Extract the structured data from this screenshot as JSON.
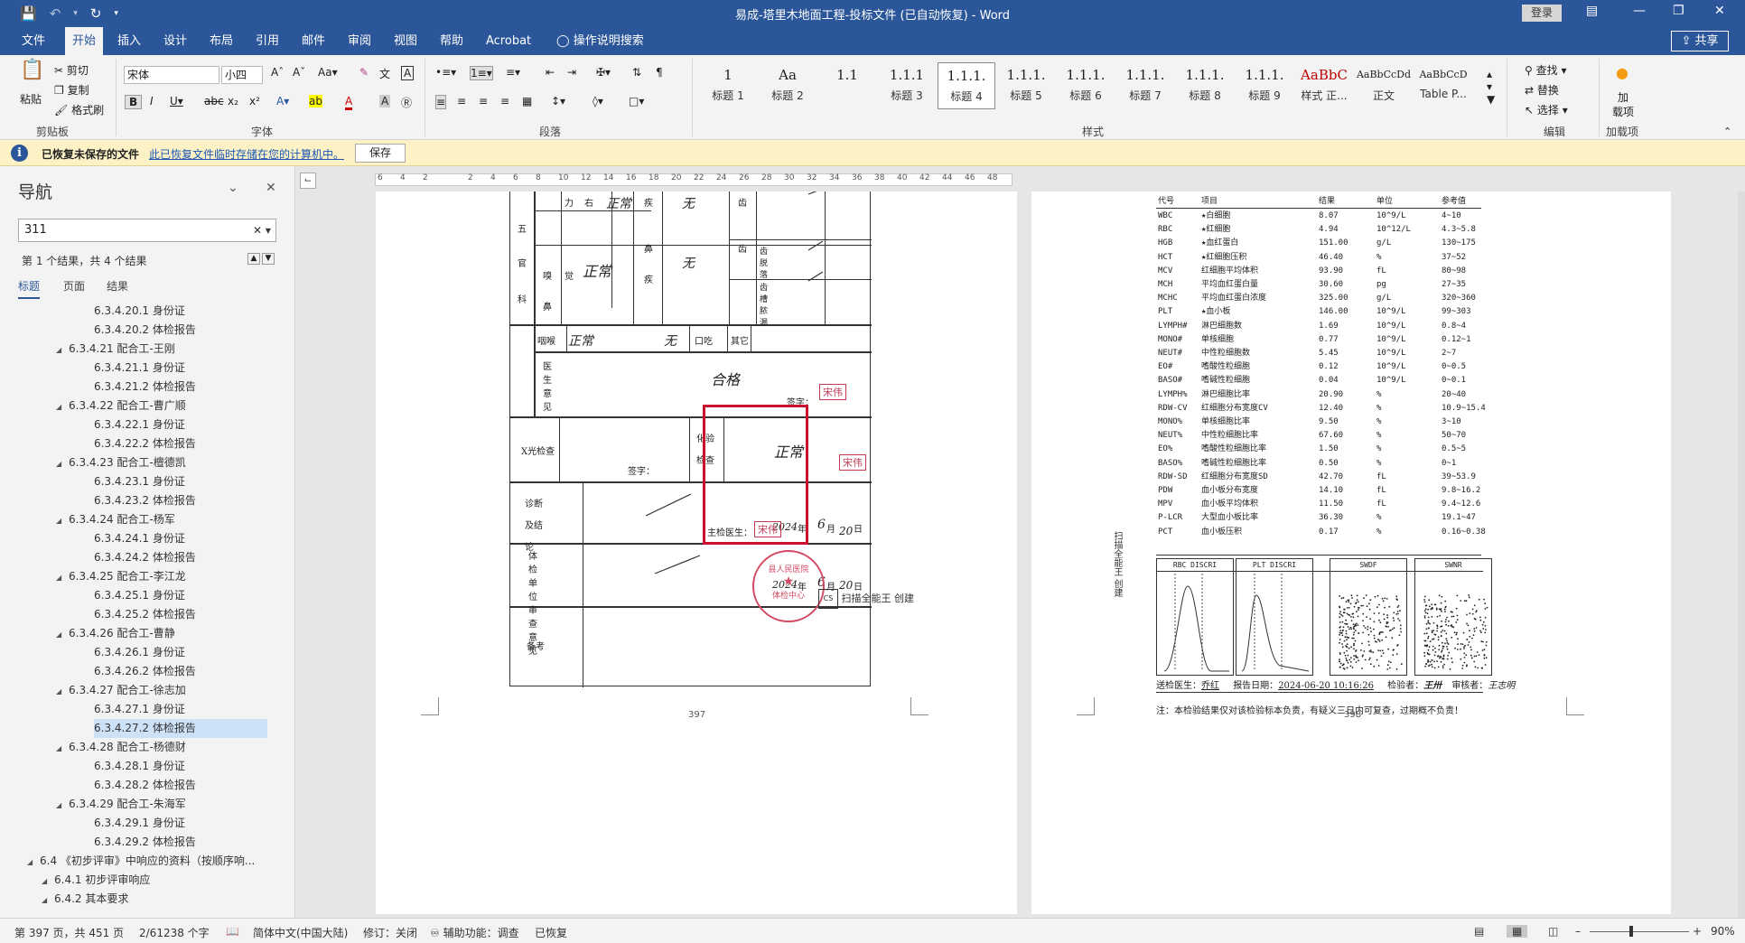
{
  "window": {
    "title": "易成-塔里木地面工程-投标文件 (已自动恢复)  -  Word",
    "login_label": "登录"
  },
  "menu": {
    "tabs": [
      "文件",
      "开始",
      "插入",
      "设计",
      "布局",
      "引用",
      "邮件",
      "审阅",
      "视图",
      "帮助",
      "Acrobat",
      "操作说明搜索"
    ],
    "active": "开始",
    "share_label": "共享"
  },
  "ribbon": {
    "clipboard": {
      "paste": "粘贴",
      "cut": "剪切",
      "copy": "复制",
      "format_painter": "格式刷",
      "group": "剪贴板"
    },
    "font": {
      "name": "宋体",
      "size": "小四",
      "group": "字体"
    },
    "paragraph": {
      "group": "段落"
    },
    "styles": {
      "group": "样式",
      "items": [
        {
          "preview": "1",
          "name": "标题 1"
        },
        {
          "preview": "Aa",
          "name": "标题 2"
        },
        {
          "preview": "1.1",
          "name": ""
        },
        {
          "preview": "1.1.1",
          "name": "标题 3"
        },
        {
          "preview": "1.1.1.",
          "name": "标题 4"
        },
        {
          "preview": "1.1.1.",
          "name": "标题 5"
        },
        {
          "preview": "1.1.1.",
          "name": "标题 6"
        },
        {
          "preview": "1.1.1.",
          "name": "标题 7"
        },
        {
          "preview": "1.1.1.",
          "name": "标题 8"
        },
        {
          "preview": "1.1.1.",
          "name": "标题 9"
        },
        {
          "preview": "AaBbC",
          "name": "样式 正..."
        },
        {
          "preview": "AaBbCcDd",
          "name": "正文"
        },
        {
          "preview": "AaBbCcD",
          "name": "Table P..."
        }
      ],
      "selected_index": 4
    },
    "editing": {
      "find": "查找",
      "replace": "替换",
      "select": "选择",
      "group": "编辑"
    },
    "addins": {
      "label1": "加",
      "label2": "载项",
      "group": "加载项"
    }
  },
  "infobar": {
    "bold": "已恢复未保存的文件",
    "link": "此已恢复文件临时存储在您的计算机中。",
    "save": "保存"
  },
  "nav": {
    "title": "导航",
    "search_value": "311",
    "result": "第 1 个结果，共 4 个结果",
    "tabs": [
      "标题",
      "页面",
      "结果"
    ],
    "items": [
      {
        "text": "6.3.4.20.1 身份证",
        "level": 2
      },
      {
        "text": "6.3.4.20.2 体检报告",
        "level": 2
      },
      {
        "text": "6.3.4.21 配合工-王刚",
        "level": 1
      },
      {
        "text": "6.3.4.21.1 身份证",
        "level": 2
      },
      {
        "text": "6.3.4.21.2 体检报告",
        "level": 2
      },
      {
        "text": "6.3.4.22 配合工-曹广顺",
        "level": 1
      },
      {
        "text": "6.3.4.22.1 身份证",
        "level": 2
      },
      {
        "text": "6.3.4.22.2 体检报告",
        "level": 2
      },
      {
        "text": "6.3.4.23 配合工-檀德凯",
        "level": 1
      },
      {
        "text": "6.3.4.23.1 身份证",
        "level": 2
      },
      {
        "text": "6.3.4.23.2 体检报告",
        "level": 2
      },
      {
        "text": "6.3.4.24 配合工-杨军",
        "level": 1
      },
      {
        "text": "6.3.4.24.1 身份证",
        "level": 2
      },
      {
        "text": "6.3.4.24.2 体检报告",
        "level": 2
      },
      {
        "text": "6.3.4.25 配合工-李江龙",
        "level": 1
      },
      {
        "text": "6.3.4.25.1 身份证",
        "level": 2
      },
      {
        "text": "6.3.4.25.2 体检报告",
        "level": 2
      },
      {
        "text": "6.3.4.26 配合工-曹静",
        "level": 1
      },
      {
        "text": "6.3.4.26.1 身份证",
        "level": 2
      },
      {
        "text": "6.3.4.26.2 体检报告",
        "level": 2
      },
      {
        "text": "6.3.4.27 配合工-徐志加",
        "level": 1
      },
      {
        "text": "6.3.4.27.1 身份证",
        "level": 2
      },
      {
        "text": "6.3.4.27.2 体检报告",
        "level": 2,
        "selected": true
      },
      {
        "text": "6.3.4.28 配合工-杨德财",
        "level": 1
      },
      {
        "text": "6.3.4.28.1 身份证",
        "level": 2
      },
      {
        "text": "6.3.4.28.2 体检报告",
        "level": 2
      },
      {
        "text": "6.3.4.29 配合工-朱海军",
        "level": 1
      },
      {
        "text": "6.3.4.29.1 身份证",
        "level": 2
      },
      {
        "text": "6.3.4.29.2 体检报告",
        "level": 2
      },
      {
        "text": "6.4 《初步评审》中响应的资料（按顺序响...",
        "level": -1
      },
      {
        "text": "6.4.1 初步评审响应",
        "level": 0
      },
      {
        "text": "6.4.2 其本要求",
        "level": 0
      }
    ]
  },
  "ruler": {
    "ticks": [
      "6",
      "4",
      "2",
      "",
      "2",
      "4",
      "6",
      "8",
      "10",
      "12",
      "14",
      "16",
      "18",
      "20",
      "22",
      "24",
      "26",
      "28",
      "30",
      "32",
      "34",
      "36",
      "38",
      "40",
      "42",
      "44",
      "46",
      "48"
    ]
  },
  "page1": {
    "page_number": "397",
    "labels": {
      "wuguan": [
        "五",
        "官",
        "科"
      ],
      "li": "力",
      "you": "右",
      "ji": "疾",
      "xiu": "嗅",
      "jue": "觉",
      "bi": "鼻",
      "bi_ji": "疾",
      "chi": "齿",
      "chi_tuo": "齿脱落",
      "chi_bing": "齿槽脓漏",
      "houlong": "咽喉",
      "kouchi": "口吃",
      "qita": "其它",
      "doctor_opinion": "医生意见",
      "sign": "签字：",
      "xray": "X光检查",
      "lab": "化验检查",
      "diagnosis": "诊断及结论",
      "chief_doctor": "主检医生：",
      "unit_opinion": "体检单位审查意见",
      "remark": "备考",
      "year": "年",
      "month": "月",
      "day": "日"
    },
    "handwriting": {
      "normal1": "正常",
      "none1": "无",
      "normal2": "正常",
      "none2": "无",
      "normal3": "正常",
      "none3": "无",
      "qualified": "合格",
      "normal4": "正常",
      "date_year": "2024",
      "date_month": "6",
      "date_day": "20",
      "stamp_name": "宋伟",
      "org_stamp_top": "县人民医院",
      "org_stamp_bottom": "体检中心"
    },
    "scanner_mark": "扫描全能王 创建"
  },
  "page2": {
    "page_number": "398",
    "headers": [
      "代号",
      "项目",
      "结果",
      "单位",
      "参考值"
    ],
    "rows": [
      [
        "WBC",
        "★白细胞",
        "8.07",
        "10^9/L",
        "4~10"
      ],
      [
        "RBC",
        "★红细胞",
        "4.94",
        "10^12/L",
        "4.3~5.8"
      ],
      [
        "HGB",
        "★血红蛋白",
        "151.00",
        "g/L",
        "130~175"
      ],
      [
        "HCT",
        "★红细胞压积",
        "46.40",
        "%",
        "37~52"
      ],
      [
        "MCV",
        "红细胞平均体积",
        "93.90",
        "fL",
        "80~98"
      ],
      [
        "MCH",
        "平均血红蛋白量",
        "30.60",
        "pg",
        "27~35"
      ],
      [
        "MCHC",
        "平均血红蛋白浓度",
        "325.00",
        "g/L",
        "320~360"
      ],
      [
        "PLT",
        "★血小板",
        "146.00",
        "10^9/L",
        "99~303"
      ],
      [
        "LYMPH#",
        "淋巴细胞数",
        "1.69",
        "10^9/L",
        "0.8~4"
      ],
      [
        "MONO#",
        "单核细胞",
        "0.77",
        "10^9/L",
        "0.12~1"
      ],
      [
        "NEUT#",
        "中性粒细胞数",
        "5.45",
        "10^9/L",
        "2~7"
      ],
      [
        "EO#",
        "嗜酸性粒细胞",
        "0.12",
        "10^9/L",
        "0~0.5"
      ],
      [
        "BASO#",
        "嗜碱性粒细胞",
        "0.04",
        "10^9/L",
        "0~0.1"
      ],
      [
        "LYMPH%",
        "淋巴细胞比率",
        "20.90",
        "%",
        "20~40"
      ],
      [
        "RDW-CV",
        "红细胞分布宽度CV",
        "12.40",
        "%",
        "10.9~15.4"
      ],
      [
        "MONO%",
        "单核细胞比率",
        "9.50",
        "%",
        "3~10"
      ],
      [
        "NEUT%",
        "中性粒细胞比率",
        "67.60",
        "%",
        "50~70"
      ],
      [
        "EO%",
        "嗜酸性粒细胞比率",
        "1.50",
        "%",
        "0.5~5"
      ],
      [
        "BASO%",
        "嗜碱性粒细胞比率",
        "0.50",
        "%",
        "0~1"
      ],
      [
        "RDW-SD",
        "红细胞分布宽度SD",
        "42.70",
        "fL",
        "39~53.9"
      ],
      [
        "PDW",
        "血小板分布宽度",
        "14.10",
        "fL",
        "9.8~16.2"
      ],
      [
        "MPV",
        "血小板平均体积",
        "11.50",
        "fL",
        "9.4~12.6"
      ],
      [
        "P-LCR",
        "大型血小板比率",
        "36.30",
        "%",
        "19.1~47"
      ],
      [
        "PCT",
        "血小板压积",
        "0.17",
        "%",
        "0.16~0.38"
      ]
    ],
    "histograms": [
      "RBC DISCRI",
      "PLT DISCRI",
      "SWDF",
      "SWNR"
    ],
    "footer": {
      "doctor_label": "送检医生：",
      "doctor": "乔红",
      "date_label": "报告日期：",
      "date": "2024-06-20 10:16:26",
      "inspector_label": "检验者：",
      "inspector": "王卅",
      "reviewer_label": "审核者：",
      "reviewer": "王志明"
    },
    "note": "注：本检验结果仅对该检验标本负责，有疑义三日内可复查，过期概不负责！",
    "side_mark": "扫描全能王 创建"
  },
  "status": {
    "page": "第 397 页，共 451 页",
    "words": "2/61238 个字",
    "lang": "简体中文(中国大陆)",
    "track": "修订：关闭",
    "access": "辅助功能：调查",
    "recovered": "已恢复",
    "zoom": "90%"
  }
}
